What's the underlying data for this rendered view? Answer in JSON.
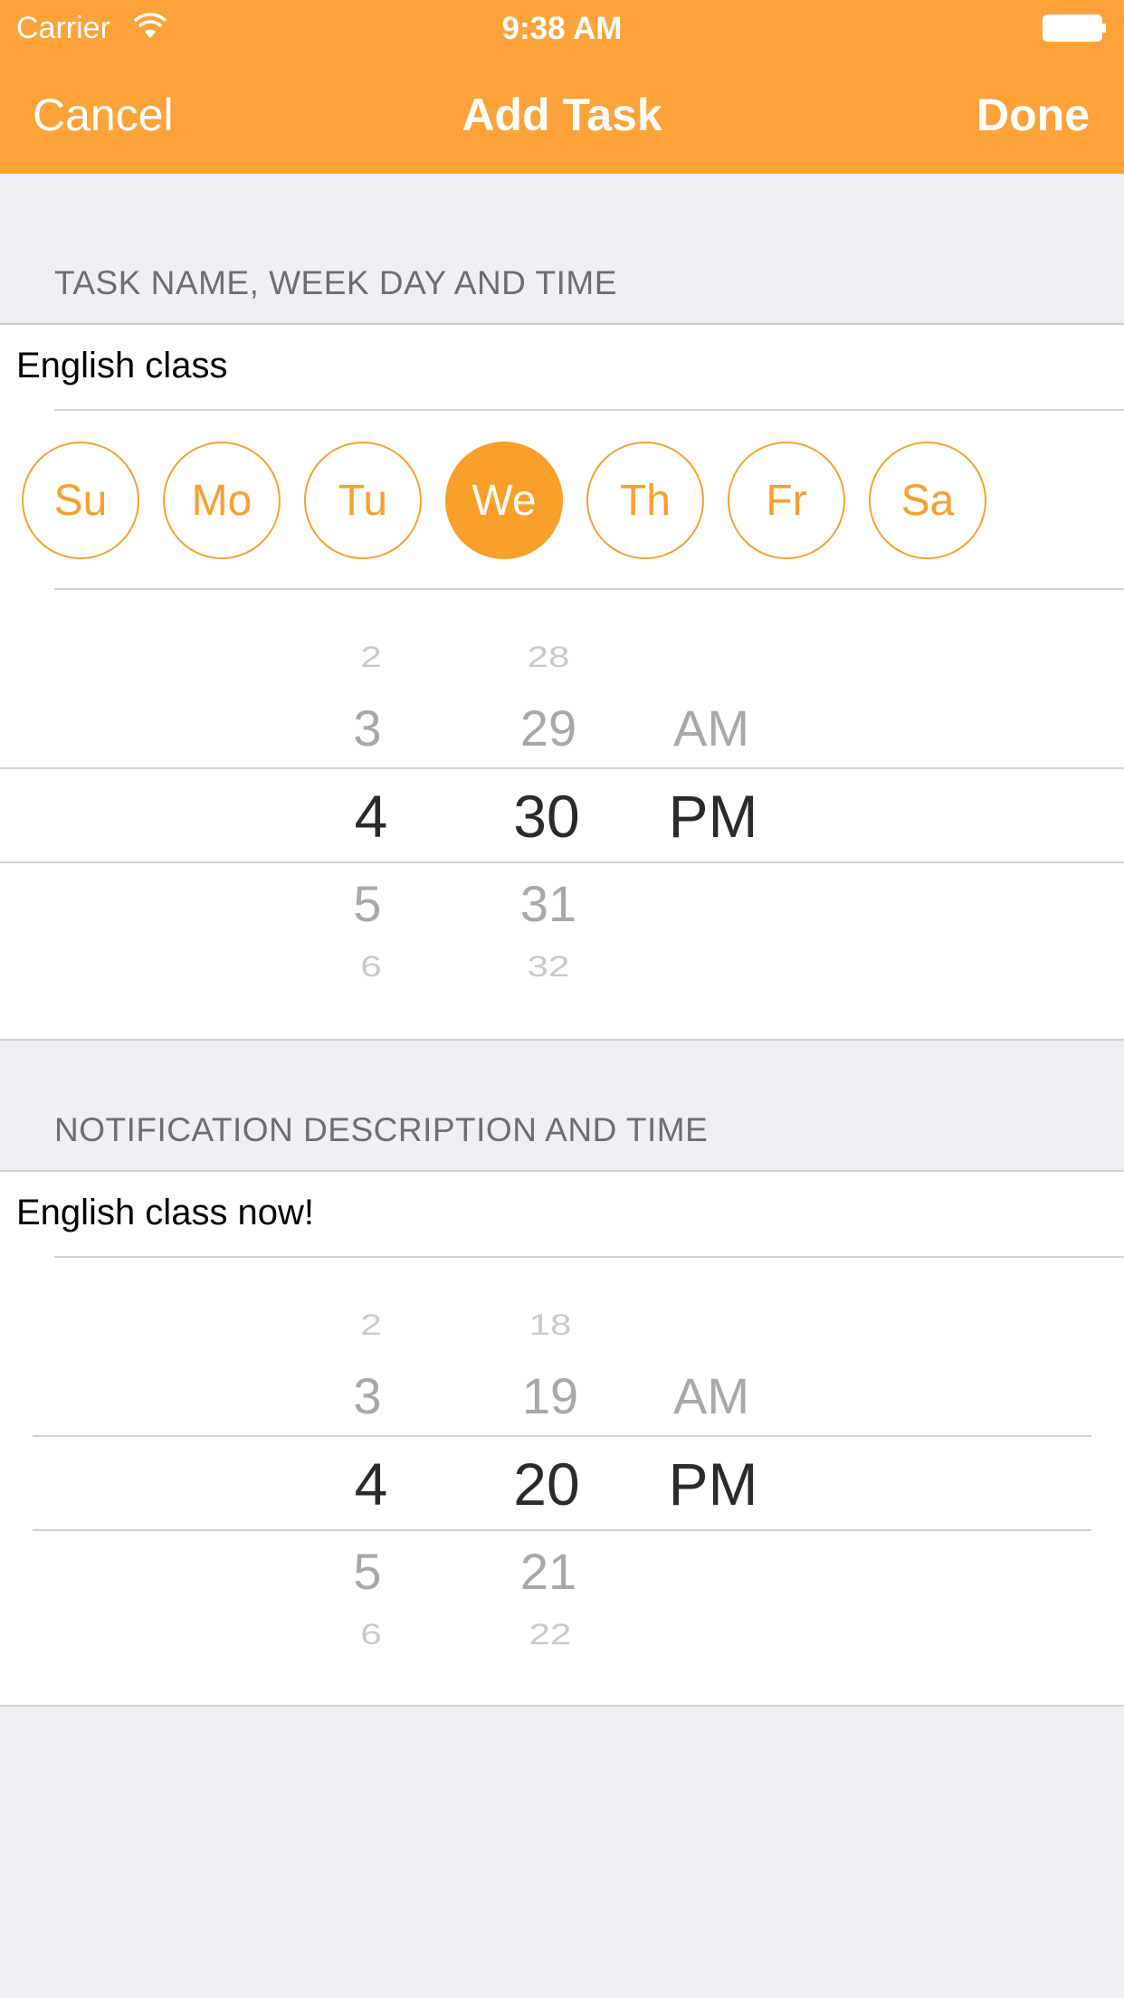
{
  "status_bar": {
    "carrier": "Carrier",
    "time": "9:38 AM"
  },
  "nav": {
    "cancel": "Cancel",
    "title": "Add Task",
    "done": "Done"
  },
  "section1": {
    "header": "TASK NAME, WEEK DAY AND TIME",
    "task_name": "English class",
    "days": [
      {
        "label": "Su",
        "selected": false
      },
      {
        "label": "Mo",
        "selected": false
      },
      {
        "label": "Tu",
        "selected": false
      },
      {
        "label": "We",
        "selected": true
      },
      {
        "label": "Th",
        "selected": false
      },
      {
        "label": "Fr",
        "selected": false
      },
      {
        "label": "Sa",
        "selected": false
      }
    ],
    "time_picker": {
      "hours": [
        "2",
        "3",
        "4",
        "5",
        "6"
      ],
      "minutes": [
        "28",
        "29",
        "30",
        "31",
        "32"
      ],
      "ampm": [
        "AM",
        "PM"
      ],
      "selected": {
        "hour": "4",
        "minute": "30",
        "ampm": "PM"
      }
    }
  },
  "section2": {
    "header": "NOTIFICATION DESCRIPTION AND TIME",
    "description": "English class now!",
    "time_picker": {
      "hours": [
        "2",
        "3",
        "4",
        "5",
        "6"
      ],
      "minutes": [
        "18",
        "19",
        "20",
        "21",
        "22"
      ],
      "ampm": [
        "AM",
        "PM"
      ],
      "selected": {
        "hour": "4",
        "minute": "20",
        "ampm": "PM"
      }
    }
  },
  "colors": {
    "accent": "#fda33a",
    "selected_day": "#f9a02a",
    "background": "#efeff4"
  }
}
